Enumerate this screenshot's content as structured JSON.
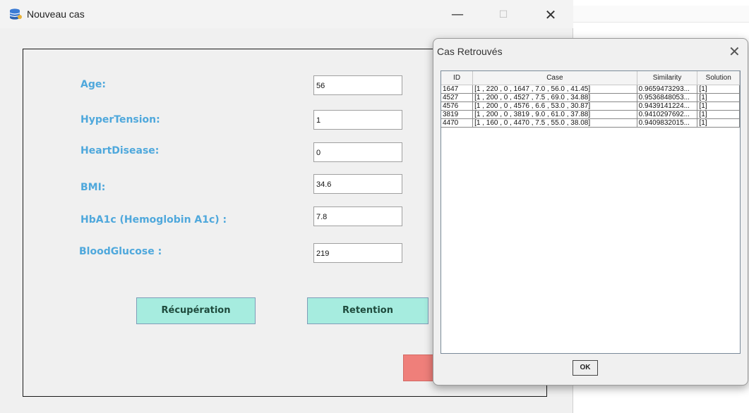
{
  "main_window": {
    "title": "Nouveau cas",
    "controls": {
      "minimize": "—",
      "maximize": "☐",
      "close": "✕"
    },
    "fields": [
      {
        "label": "Age:",
        "value": "56"
      },
      {
        "label": "HyperTension:",
        "value": "1"
      },
      {
        "label": "HeartDisease:",
        "value": "0"
      },
      {
        "label": "BMI:",
        "value": "34.6"
      },
      {
        "label": "HbA1c (Hemoglobin A1c) :",
        "value": "7.8"
      },
      {
        "label": "BloodGlucose :",
        "value": "219"
      }
    ],
    "buttons": {
      "recuperation": "Récupération",
      "retention": "Retention"
    },
    "colors": {
      "label": "#4fa8dc",
      "button": "#a6ecdf",
      "red_button": "#ef7f7a"
    }
  },
  "dialog": {
    "title": "Cas Retrouvés",
    "close": "✕",
    "columns": [
      "ID",
      "Case",
      "Similarity",
      "Solution"
    ],
    "rows": [
      [
        "1647",
        "[1 , 220 , 0 , 1647 , 7.0 , 56.0 , 41.45]",
        "0.9659473293...",
        "[1]"
      ],
      [
        "4527",
        "[1 , 200 , 0 , 4527 , 7.5 , 69.0 , 34.88]",
        "0.9536848053...",
        "[1]"
      ],
      [
        "4576",
        "[1 , 200 , 0 , 4576 , 6.6 , 53.0 , 30.87]",
        "0.9439141224...",
        "[1]"
      ],
      [
        "3819",
        "[1 , 200 , 0 , 3819 , 9.0 , 61.0 , 37.88]",
        "0.9410297692...",
        "[1]"
      ],
      [
        "4470",
        "[1 , 160 , 0 , 4470 , 7.5 , 55.0 , 38.08]",
        "0.9409832015...",
        "[1]"
      ]
    ],
    "ok": "OK"
  }
}
